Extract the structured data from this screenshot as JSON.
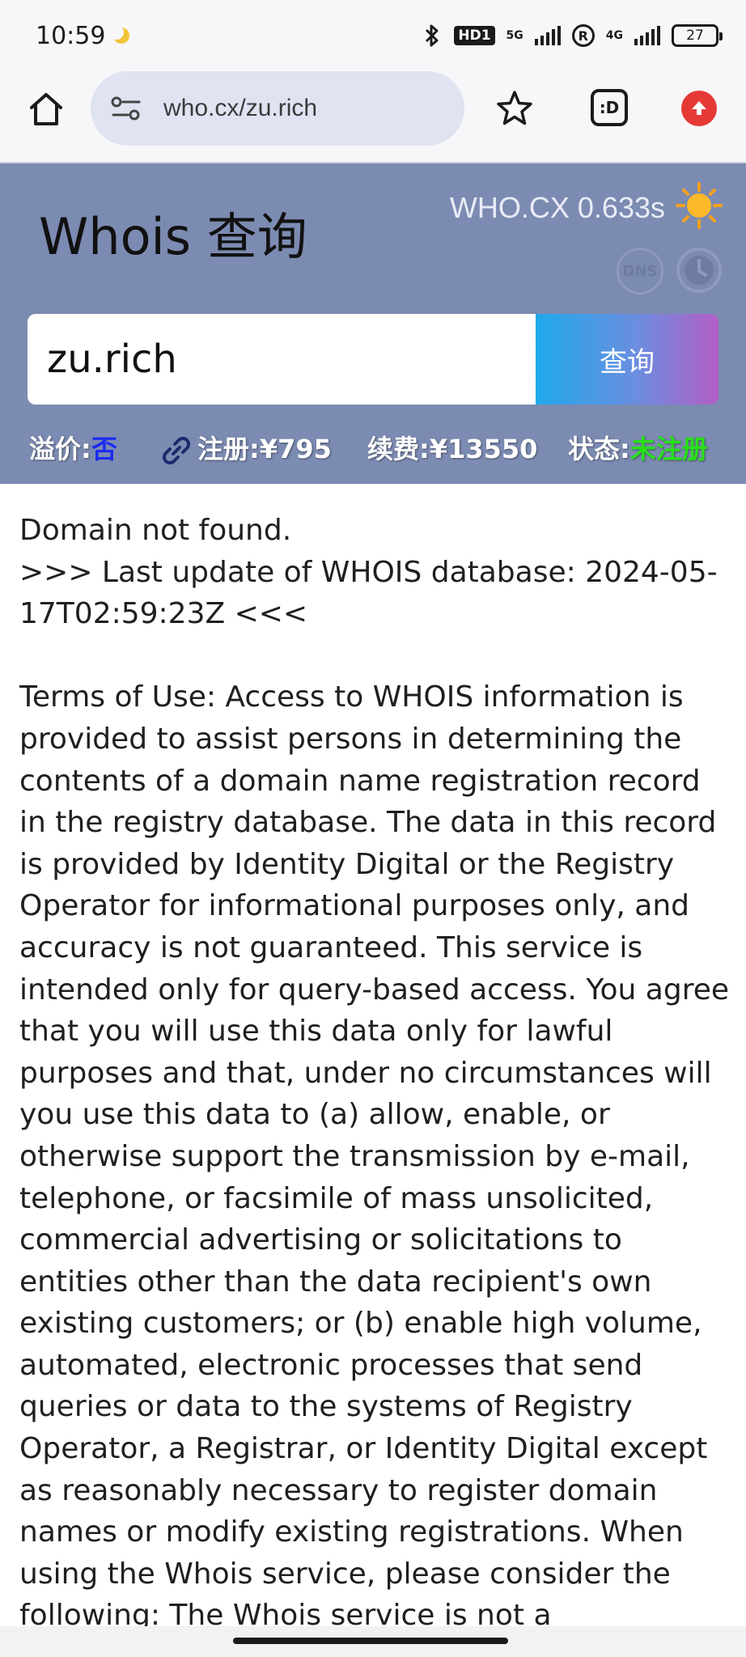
{
  "status_bar": {
    "time": "10:59",
    "hd_label": "HD1",
    "net_5g": "5G",
    "net_4g": "4G",
    "r_label": "R",
    "battery": "27"
  },
  "browser": {
    "url": "who.cx/zu.rich",
    "tab_label": ":D"
  },
  "header": {
    "title": "Whois 查询",
    "timing": "WHO.CX 0.633s",
    "dns_label": "DNS"
  },
  "search": {
    "query": "zu.rich",
    "button_label": "查询"
  },
  "info": {
    "premium_label": "溢价:",
    "premium_value": "否",
    "register_label": "注册:¥795",
    "renew_label": "续费:¥13550",
    "status_label": "状态:",
    "status_value": "未注册"
  },
  "result": {
    "text": "Domain not found.\n>>> Last update of WHOIS database: 2024-05-17T02:59:23Z <<<\n\nTerms of Use: Access to WHOIS information is provided to assist persons in determining the contents of a domain name registration record in the registry database. The data in this record is provided by Identity Digital or the Registry Operator for informational purposes only, and accuracy is not guaranteed. This service is intended only for query-based access. You agree that you will use this data only for lawful purposes and that, under no circumstances will you use this data to (a) allow, enable, or otherwise support the transmission by e-mail, telephone, or facsimile of mass unsolicited, commercial advertising or solicitations to entities other than the data recipient's own existing customers; or (b) enable high volume, automated, electronic processes that send queries or data to the systems of Registry Operator, a Registrar, or Identity Digital except as reasonably necessary to register domain names or modify existing registrations. When using the Whois service, please consider the following: The Whois service is not a replacement for"
  },
  "colors": {
    "header_bg": "#7c8bb2",
    "premium_value": "#1b2cf0",
    "status_value": "#28e01a",
    "button_gradient_start": "#1fa9ea",
    "button_gradient_end": "#b35ec5"
  },
  "icons": [
    "home-icon",
    "site-settings-icon",
    "star-icon",
    "tab-switcher-icon",
    "extension-icon",
    "sun-icon",
    "dns-icon",
    "history-clock-icon",
    "link-icon"
  ]
}
